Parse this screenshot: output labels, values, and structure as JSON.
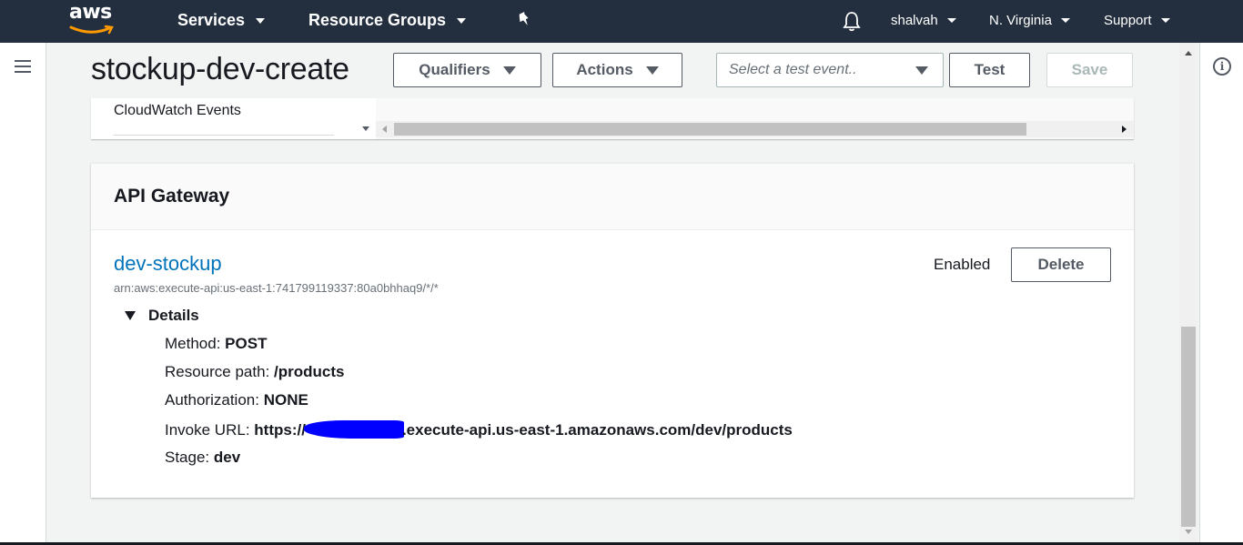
{
  "nav": {
    "logo": "aws",
    "services_label": "Services",
    "resource_groups_label": "Resource Groups",
    "user_label": "shalvah",
    "region_label": "N. Virginia",
    "support_label": "Support",
    "bg_color": "#232f3e"
  },
  "header": {
    "function_name": "stockup-dev-create",
    "qualifiers_label": "Qualifiers",
    "actions_label": "Actions",
    "test_event_placeholder": "Select a test event..",
    "test_label": "Test",
    "save_label": "Save"
  },
  "triggers": {
    "items": [
      {
        "label": "CloudWatch Events"
      }
    ]
  },
  "api_gateway": {
    "title": "API Gateway",
    "name": "dev-stockup",
    "arn": "arn:aws:execute-api:us-east-1:741799119337:80a0bhhaq9/*/*",
    "status": "Enabled",
    "delete_label": "Delete",
    "details_label": "Details",
    "details": {
      "method_label": "Method:",
      "method_value": "POST",
      "resource_path_label": "Resource path:",
      "resource_path_value": "/products",
      "authorization_label": "Authorization:",
      "authorization_value": "NONE",
      "invoke_url_label": "Invoke URL:",
      "invoke_url_prefix": "https://",
      "invoke_url_suffix": ".execute-api.us-east-1.amazonaws.com/dev/products",
      "stage_label": "Stage:",
      "stage_value": "dev"
    },
    "link_color": "#0073bb"
  },
  "icons": {
    "pin": "pin-icon",
    "bell": "bell-icon",
    "menu": "hamburger-icon",
    "info": "info-icon"
  }
}
